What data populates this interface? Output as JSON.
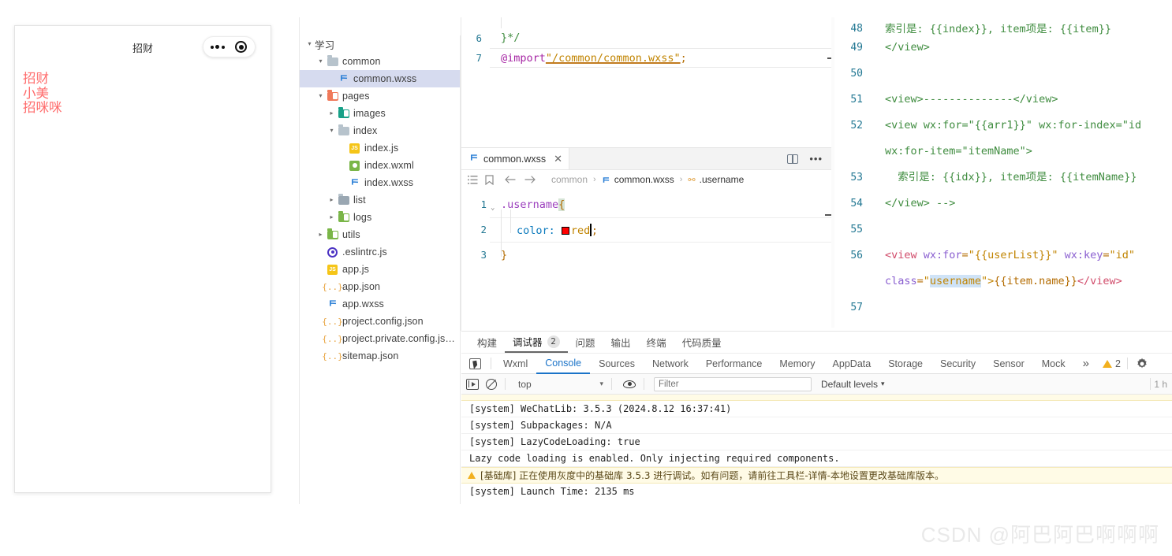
{
  "simulator": {
    "title": "招财",
    "capsule": {
      "menu_icon": "more-dots-icon",
      "target_icon": "target-circle-icon"
    },
    "user_list": [
      "招财",
      "小美",
      "招咪咪"
    ]
  },
  "filetree": {
    "root": {
      "label": "学习",
      "twisty": "▾"
    },
    "items": [
      {
        "label": "common",
        "depth": 1,
        "twisty": "▾",
        "icon": "folder-gray-icon",
        "selected": false
      },
      {
        "label": "common.wxss",
        "depth": 2,
        "twisty": "",
        "icon": "wxss-file-icon",
        "selected": true
      },
      {
        "label": "pages",
        "depth": 1,
        "twisty": "▾",
        "icon": "folder-red-icon",
        "selected": false
      },
      {
        "label": "images",
        "depth": 2,
        "twisty": "▸",
        "icon": "folder-teal-icon",
        "selected": false
      },
      {
        "label": "index",
        "depth": 2,
        "twisty": "▾",
        "icon": "folder-gray-icon",
        "selected": false
      },
      {
        "label": "index.js",
        "depth": 3,
        "twisty": "",
        "icon": "js-file-icon",
        "selected": false
      },
      {
        "label": "index.wxml",
        "depth": 3,
        "twisty": "",
        "icon": "wxml-file-icon",
        "selected": false
      },
      {
        "label": "index.wxss",
        "depth": 3,
        "twisty": "",
        "icon": "wxss-file-icon",
        "selected": false
      },
      {
        "label": "list",
        "depth": 2,
        "twisty": "▸",
        "icon": "folder-dark-icon",
        "selected": false
      },
      {
        "label": "logs",
        "depth": 2,
        "twisty": "▸",
        "icon": "folder-green-icon",
        "selected": false
      },
      {
        "label": "utils",
        "depth": 1,
        "twisty": "▸",
        "icon": "folder-green-icon",
        "selected": false
      },
      {
        "label": ".eslintrc.js",
        "depth": 1,
        "twisty": "",
        "icon": "eslint-file-icon",
        "selected": false
      },
      {
        "label": "app.js",
        "depth": 1,
        "twisty": "",
        "icon": "js-file-icon",
        "selected": false
      },
      {
        "label": "app.json",
        "depth": 1,
        "twisty": "",
        "icon": "json-file-icon",
        "selected": false
      },
      {
        "label": "app.wxss",
        "depth": 1,
        "twisty": "",
        "icon": "wxss-file-icon",
        "selected": false
      },
      {
        "label": "project.config.json",
        "depth": 1,
        "twisty": "",
        "icon": "json-file-icon",
        "selected": false
      },
      {
        "label": "project.private.config.js…",
        "depth": 1,
        "twisty": "",
        "icon": "json-file-icon",
        "selected": false
      },
      {
        "label": "sitemap.json",
        "depth": 1,
        "twisty": "",
        "icon": "json-file-icon",
        "selected": false
      }
    ]
  },
  "editor_top": {
    "lines": [
      {
        "no": "6",
        "text": "}*/"
      },
      {
        "no": "7",
        "text": "@import\"/common/common.wxss\";"
      }
    ],
    "import_keyword": "@import",
    "import_path": "\"/common/common.wxss\"",
    "import_semi": ";",
    "comment_close": "}*/"
  },
  "editor_bottom": {
    "tab": {
      "label": "common.wxss",
      "close": "✕",
      "icon": "wxss-file-icon"
    },
    "actions": {
      "split": "split-editor-icon",
      "more": "more-actions-icon"
    },
    "breadcrumb": {
      "outline_icon": "outline-icon",
      "bookmark_icon": "bookmark-icon",
      "back_icon": "arrow-left-icon",
      "forward_icon": "arrow-right-icon",
      "parts": [
        "common",
        "common.wxss",
        ".username"
      ],
      "separator": "›"
    },
    "lines": [
      {
        "no": "1",
        "selector": ".username",
        "brace": "{"
      },
      {
        "no": "2",
        "prop": "color:",
        "value": "red",
        "semi": ";",
        "swatch_color": "#ff0000"
      },
      {
        "no": "3",
        "brace": "}"
      }
    ]
  },
  "editor_right": {
    "lines": [
      {
        "no": "48",
        "text": "索引是: {{index}}, item项是: {{item}}",
        "style": "comment",
        "clipped": true
      },
      {
        "no": "49",
        "text": "</view>",
        "style": "comment"
      },
      {
        "no": "50",
        "text": "",
        "style": "comment"
      },
      {
        "no": "51",
        "text": "<view>--------------</view>",
        "style": "comment"
      },
      {
        "no": "52",
        "text": "<view wx:for=\"{{arr1}}\" wx:for-index=\"id",
        "style": "comment",
        "cont": "wx:for-item=\"itemName\">"
      },
      {
        "no": "53",
        "text": "  索引是: {{idx}}, item项是: {{itemName}}",
        "style": "comment"
      },
      {
        "no": "54",
        "text": "</view> -->",
        "style": "comment"
      },
      {
        "no": "55",
        "text": "",
        "style": "comment"
      },
      {
        "no": "56",
        "text": "<view wx:for=\"{{userList}}\" wx:key=\"id\"",
        "style": "code",
        "cont": "class=\"username\">{{item.name}}</view>"
      },
      {
        "no": "57",
        "text": "",
        "style": "code"
      }
    ],
    "line56": {
      "tag_open": "<view",
      "attr1": " wx:for",
      "eq": "=",
      "val1": "\"{{userList}}\"",
      "attr2": " wx:key",
      "val2": "\"id\"",
      "attr3": "class",
      "val3_quote": "\"",
      "val3_hl": "username",
      "gt": "\">",
      "mustache": "{{item.name}}",
      "tag_close": "</view>"
    }
  },
  "console": {
    "dev_tabs": [
      {
        "label": "构建",
        "active": false,
        "badge": null
      },
      {
        "label": "调试器",
        "active": true,
        "badge": "2"
      },
      {
        "label": "问题",
        "active": false,
        "badge": null
      },
      {
        "label": "输出",
        "active": false,
        "badge": null
      },
      {
        "label": "终端",
        "active": false,
        "badge": null
      },
      {
        "label": "代码质量",
        "active": false,
        "badge": null
      }
    ],
    "sub_tabs": [
      {
        "label": "Wxml",
        "active": false
      },
      {
        "label": "Console",
        "active": true
      },
      {
        "label": "Sources",
        "active": false
      },
      {
        "label": "Network",
        "active": false
      },
      {
        "label": "Performance",
        "active": false
      },
      {
        "label": "Memory",
        "active": false
      },
      {
        "label": "AppData",
        "active": false
      },
      {
        "label": "Storage",
        "active": false
      },
      {
        "label": "Security",
        "active": false
      },
      {
        "label": "Sensor",
        "active": false
      },
      {
        "label": "Mock",
        "active": false
      }
    ],
    "overflow_label": "»",
    "warning_count": "2",
    "gear_icon": "settings-gear-icon",
    "filterbar": {
      "execute_icon": "execute-context-icon",
      "clear_icon": "clear-console-icon",
      "context": "top",
      "context_caret": "▾",
      "eye_icon": "live-expression-icon",
      "filter_placeholder": "Filter",
      "filter_value": "",
      "levels": "Default levels",
      "levels_caret": "▾",
      "right_note": "1 h"
    },
    "messages": [
      {
        "text": "[system] WeChatLib: 3.5.3 (2024.8.12 16:37:41)",
        "type": "info"
      },
      {
        "text": "[system] Subpackages: N/A",
        "type": "info"
      },
      {
        "text": "[system] LazyCodeLoading: true",
        "type": "info"
      },
      {
        "text": "Lazy code loading is enabled. Only injecting required components.",
        "type": "info"
      },
      {
        "text": "[基础库] 正在使用灰度中的基础库 3.5.3 进行调试。如有问题，请前往工具栏-详情-本地设置更改基础库版本。",
        "type": "warning"
      },
      {
        "text": "[system] Launch Time: 2135 ms",
        "type": "info"
      }
    ]
  },
  "watermark": {
    "text": "CSDN @阿巴阿巴啊啊啊"
  }
}
